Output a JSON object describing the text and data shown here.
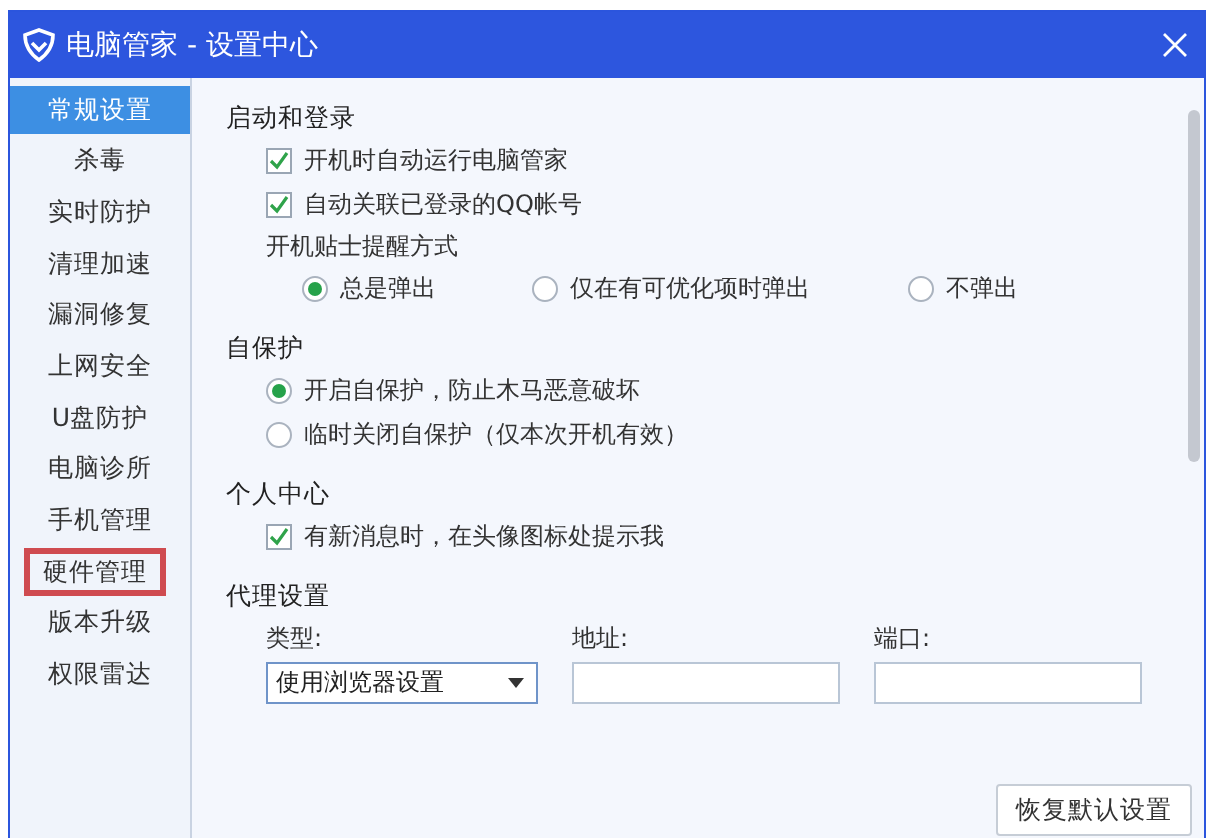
{
  "window": {
    "title": "电脑管家 - 设置中心"
  },
  "sidebar": {
    "items": [
      {
        "label": "常规设置",
        "selected": true,
        "outlined": false
      },
      {
        "label": "杀毒",
        "selected": false,
        "outlined": false
      },
      {
        "label": "实时防护",
        "selected": false,
        "outlined": false
      },
      {
        "label": "清理加速",
        "selected": false,
        "outlined": false
      },
      {
        "label": "漏洞修复",
        "selected": false,
        "outlined": false
      },
      {
        "label": "上网安全",
        "selected": false,
        "outlined": false
      },
      {
        "label": "U盘防护",
        "selected": false,
        "outlined": false
      },
      {
        "label": "电脑诊所",
        "selected": false,
        "outlined": false
      },
      {
        "label": "手机管理",
        "selected": false,
        "outlined": false
      },
      {
        "label": "硬件管理",
        "selected": false,
        "outlined": true
      },
      {
        "label": "版本升级",
        "selected": false,
        "outlined": false
      },
      {
        "label": "权限雷达",
        "selected": false,
        "outlined": false
      }
    ]
  },
  "sections": [
    {
      "title": "启动和登录",
      "items": [
        {
          "kind": "checkbox",
          "label": "开机时自动运行电脑管家",
          "checked": true
        },
        {
          "kind": "checkbox",
          "label": "自动关联已登录的QQ帐号",
          "checked": true
        },
        {
          "kind": "label",
          "label": "开机贴士提醒方式"
        },
        {
          "kind": "radio-row",
          "options": [
            {
              "label": "总是弹出",
              "selected": true
            },
            {
              "label": "仅在有可优化项时弹出",
              "selected": false
            },
            {
              "label": "不弹出",
              "selected": false
            }
          ]
        }
      ]
    },
    {
      "title": "自保护",
      "items": [
        {
          "kind": "radio",
          "label": "开启自保护，防止木马恶意破坏",
          "selected": true
        },
        {
          "kind": "radio",
          "label": "临时关闭自保护（仅本次开机有效）",
          "selected": false
        }
      ]
    },
    {
      "title": "个人中心",
      "items": [
        {
          "kind": "checkbox",
          "label": "有新消息时，在头像图标处提示我",
          "checked": true
        }
      ]
    },
    {
      "title": "代理设置",
      "items": [
        {
          "kind": "fields",
          "fields": [
            {
              "kind": "dropdown",
              "label": "类型:",
              "value": "使用浏览器设置"
            },
            {
              "kind": "text",
              "label": "地址:"
            },
            {
              "kind": "text",
              "label": "端口:"
            }
          ]
        }
      ]
    }
  ],
  "restore_button": {
    "label": "恢复默认设置"
  }
}
